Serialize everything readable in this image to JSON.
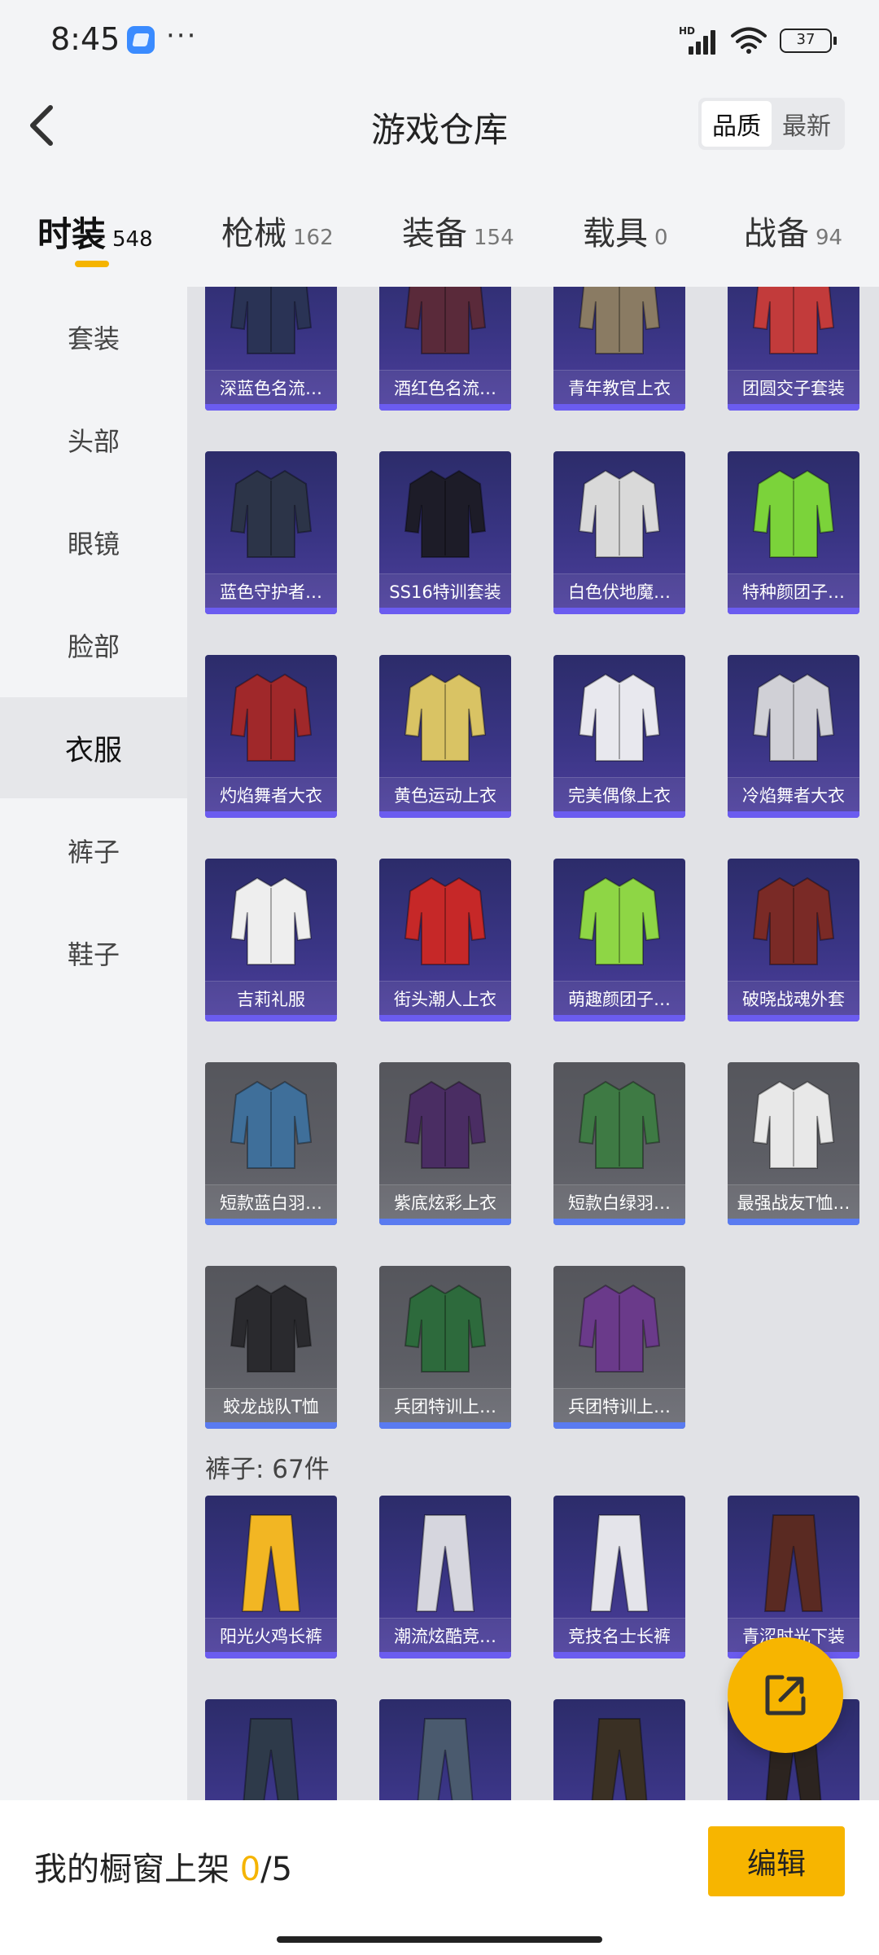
{
  "status_bar": {
    "time": "8:45",
    "dots": "···",
    "signal_label": "HD",
    "battery": "37"
  },
  "header": {
    "title": "游戏仓库",
    "sort_options": [
      "品质",
      "最新"
    ],
    "active_sort": "品质"
  },
  "tabs": [
    {
      "name": "时装",
      "count": "548"
    },
    {
      "name": "枪械",
      "count": "162"
    },
    {
      "name": "装备",
      "count": "154"
    },
    {
      "name": "载具",
      "count": "0"
    },
    {
      "name": "战备",
      "count": "94"
    }
  ],
  "sidebar": [
    {
      "label": "套装"
    },
    {
      "label": "头部"
    },
    {
      "label": "眼镜"
    },
    {
      "label": "脸部"
    },
    {
      "label": "衣服"
    },
    {
      "label": "裤子"
    },
    {
      "label": "鞋子"
    }
  ],
  "clothes_items": [
    {
      "name": "深蓝色名流…",
      "color": "#2a3355"
    },
    {
      "name": "酒红色名流…",
      "color": "#5a2a3a"
    },
    {
      "name": "青年教官上衣",
      "color": "#8a7b63"
    },
    {
      "name": "团圆交子套装",
      "color": "#c23b3b"
    },
    {
      "name": "蓝色守护者…",
      "color": "#2c3448"
    },
    {
      "name": "SS16特训套装",
      "color": "#1d1c28"
    },
    {
      "name": "白色伏地魔…",
      "color": "#d9d9d9"
    },
    {
      "name": "特种颜团子…",
      "color": "#7bd33a"
    },
    {
      "name": "灼焰舞者大衣",
      "color": "#a0282a"
    },
    {
      "name": "黄色运动上衣",
      "color": "#d9c364"
    },
    {
      "name": "完美偶像上衣",
      "color": "#e8e8ee"
    },
    {
      "name": "冷焰舞者大衣",
      "color": "#d0d0d6"
    },
    {
      "name": "吉莉礼服",
      "color": "#eeeeee"
    },
    {
      "name": "街头潮人上衣",
      "color": "#c62828"
    },
    {
      "name": "萌趣颜团子…",
      "color": "#8ed645"
    },
    {
      "name": "破晓战魂外套",
      "color": "#7a2a26"
    },
    {
      "name": "短款蓝白羽…",
      "color": "#3f6f9a"
    },
    {
      "name": "紫底炫彩上衣",
      "color": "#4a2d63"
    },
    {
      "name": "短款白绿羽…",
      "color": "#3e7a44"
    },
    {
      "name": "最强战友T恤…",
      "color": "#e8e8e8"
    },
    {
      "name": "蛟龙战队T恤",
      "color": "#2a2a2e"
    },
    {
      "name": "兵团特训上…",
      "color": "#2d6a3c"
    },
    {
      "name": "兵团特训上…",
      "color": "#6a3a8a"
    }
  ],
  "pants_section": {
    "title": "裤子: 67件"
  },
  "pants_items": [
    {
      "name": "阳光火鸡长裤",
      "color": "#f2b623"
    },
    {
      "name": "潮流炫酷竞…",
      "color": "#d6d6de"
    },
    {
      "name": "竞技名士长裤",
      "color": "#e4e4ea"
    },
    {
      "name": "青涩时光下装",
      "color": "#5a2a22"
    },
    {
      "name": "",
      "color": "#2e3a4a"
    },
    {
      "name": "",
      "color": "#4a5a6e"
    },
    {
      "name": "",
      "color": "#3a3024"
    },
    {
      "name": "",
      "color": "#2c2420"
    }
  ],
  "bottom": {
    "showcase_label": "我的橱窗上架",
    "showcase_current": "0",
    "showcase_total": "/5",
    "edit_label": "编辑"
  },
  "colors": {
    "accent": "#f7b500",
    "card_purple": "#3a3585",
    "card_gray": "#5d5e65"
  }
}
